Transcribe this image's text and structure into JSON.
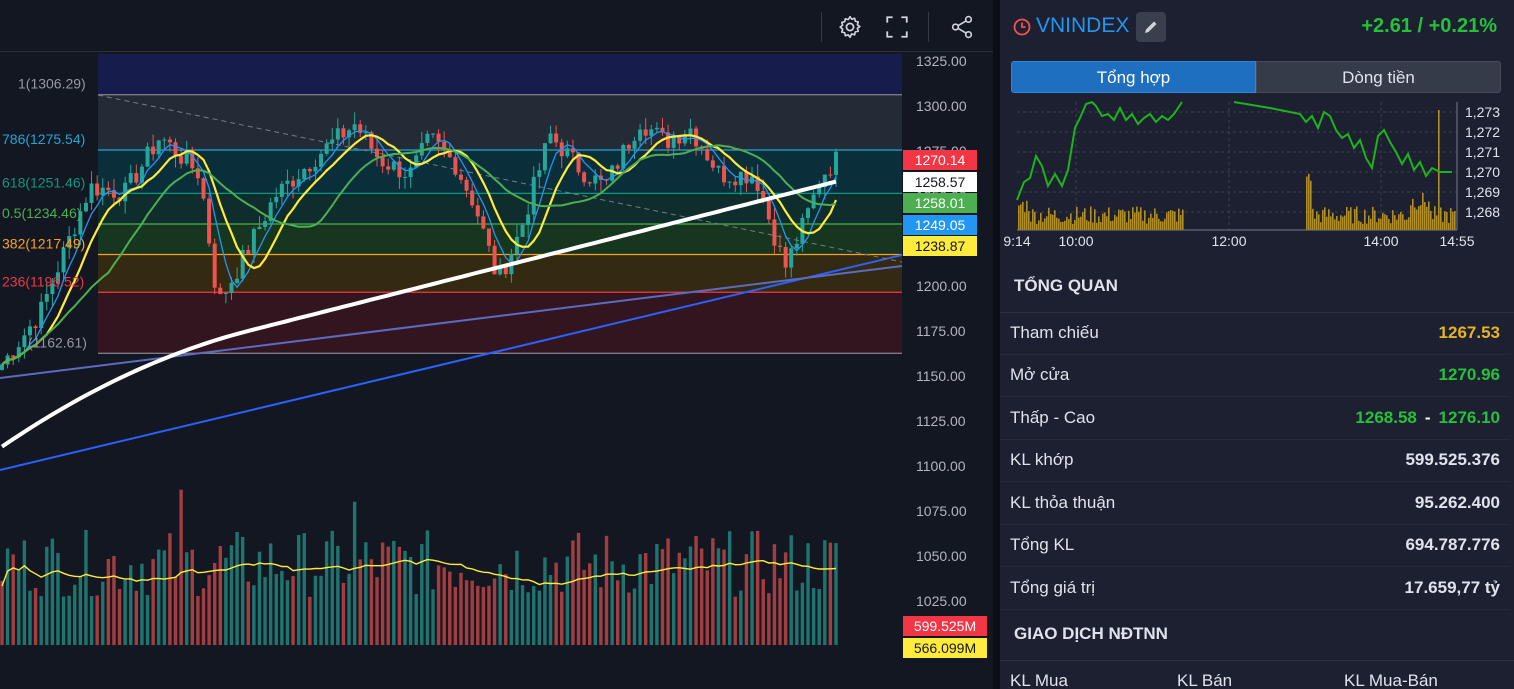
{
  "toolbar": {
    "settings_icon": "gear-icon",
    "fullscreen_icon": "fullscreen-icon",
    "share_icon": "share-icon"
  },
  "chart": {
    "y_axis_ticks": [
      "1325.00",
      "1300.00",
      "1275.00",
      "1250.00",
      "1225.00",
      "1200.00",
      "1175.00",
      "1150.00",
      "1125.00",
      "1100.00",
      "1075.00",
      "1050.00",
      "1025.00"
    ],
    "fib_levels": [
      {
        "label": "1(1306.29)",
        "price": 1306.29,
        "color": "#787b86"
      },
      {
        "label": "786(1275.54)",
        "price": 1275.54,
        "color": "#22a6d6"
      },
      {
        "label": "618(1251.46)",
        "price": 1251.46,
        "color": "#089981"
      },
      {
        "label": "0.5(1234.46)",
        "price": 1234.46,
        "color": "#4caf50"
      },
      {
        "label": "382(1217.49)",
        "price": 1217.49,
        "color": "#f7a21b"
      },
      {
        "label": "236(1196.52)",
        "price": 1196.52,
        "color": "#f23645"
      },
      {
        "label": "(1162.61)",
        "price": 1162.61,
        "color": "#787b86"
      }
    ],
    "price_tags": [
      {
        "text": "1270.14",
        "bg": "#f23645",
        "fg": "#ffffff"
      },
      {
        "text": "1258.57",
        "bg": "#ffffff",
        "fg": "#131722"
      },
      {
        "text": "1258.01",
        "bg": "#4caf50",
        "fg": "#ffffff"
      },
      {
        "text": "1249.05",
        "bg": "#2196f3",
        "fg": "#ffffff"
      },
      {
        "text": "1238.87",
        "bg": "#ffeb3b",
        "fg": "#131722"
      }
    ],
    "volume_tags": [
      {
        "text": "599.525M",
        "bg": "#f23645",
        "fg": "#ffffff"
      },
      {
        "text": "566.099M",
        "bg": "#ffeb3b",
        "fg": "#131722"
      }
    ]
  },
  "symbol": {
    "name": "VNINDEX",
    "change": "+2.61 / +0.21%",
    "clock_icon": "clock-icon",
    "edit_icon": "pencil-icon"
  },
  "tabs": [
    {
      "label": "Tổng hợp",
      "active": true
    },
    {
      "label": "Dòng tiền",
      "active": false
    }
  ],
  "intraday": {
    "y_ticks": [
      "1,273",
      "1,272",
      "1,271",
      "1,270",
      "1,269",
      "1,268"
    ],
    "x_ticks": [
      "9:14",
      "10:00",
      "12:00",
      "14:00",
      "14:55"
    ]
  },
  "overview": {
    "title": "TỔNG QUAN",
    "rows": [
      {
        "label": "Tham chiếu",
        "value": "1267.53"
      },
      {
        "label": "Mở cửa",
        "value": "1270.96"
      },
      {
        "label": "Thấp - Cao",
        "low": "1268.58",
        "dash": "-",
        "high": "1276.10"
      },
      {
        "label": "KL khớp",
        "value": "599.525.376"
      },
      {
        "label": "KL thỏa thuận",
        "value": "95.262.400"
      },
      {
        "label": "Tổng KL",
        "value": "694.787.776"
      },
      {
        "label": "Tổng giá trị",
        "value": "17.659,77 tỷ"
      }
    ]
  },
  "foreign": {
    "title": "GIAO DỊCH NĐTNN",
    "columns": [
      "KL Mua",
      "KL Bán",
      "KL Mua-Bán"
    ]
  },
  "colors": {
    "up": "#26a69a",
    "down": "#ef5350",
    "accent": "#2196f3",
    "positive_text": "#26c13a",
    "reference_text": "#e6b422"
  }
}
